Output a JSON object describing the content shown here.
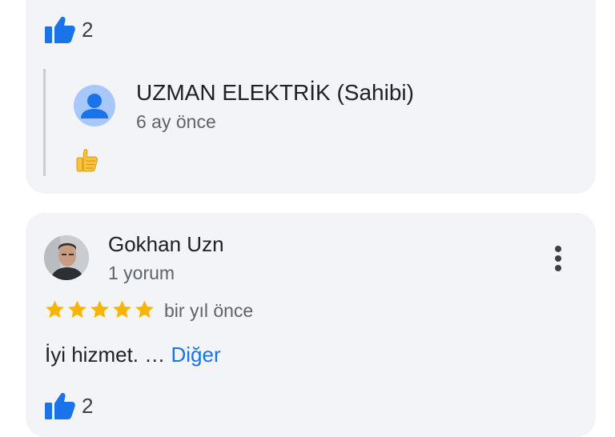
{
  "top_review": {
    "like_count": "2",
    "owner_reply": {
      "name": "UZMAN ELEKTRİK (Sahibi)",
      "time": "6 ay önce",
      "reaction_icon": "thumbs-up-emoji"
    }
  },
  "review": {
    "reviewer_name": "Gokhan Uzn",
    "reviewer_meta": "1 yorum",
    "rating": 5,
    "rating_max": 5,
    "time": "bir yıl önce",
    "text": "İyi hizmet. …",
    "more_label": "Diğer",
    "like_count": "2"
  },
  "colors": {
    "card_bg": "#f3f4f7",
    "like_icon": "#1a73e8",
    "star": "#f7b500",
    "link": "#1a73e8"
  }
}
